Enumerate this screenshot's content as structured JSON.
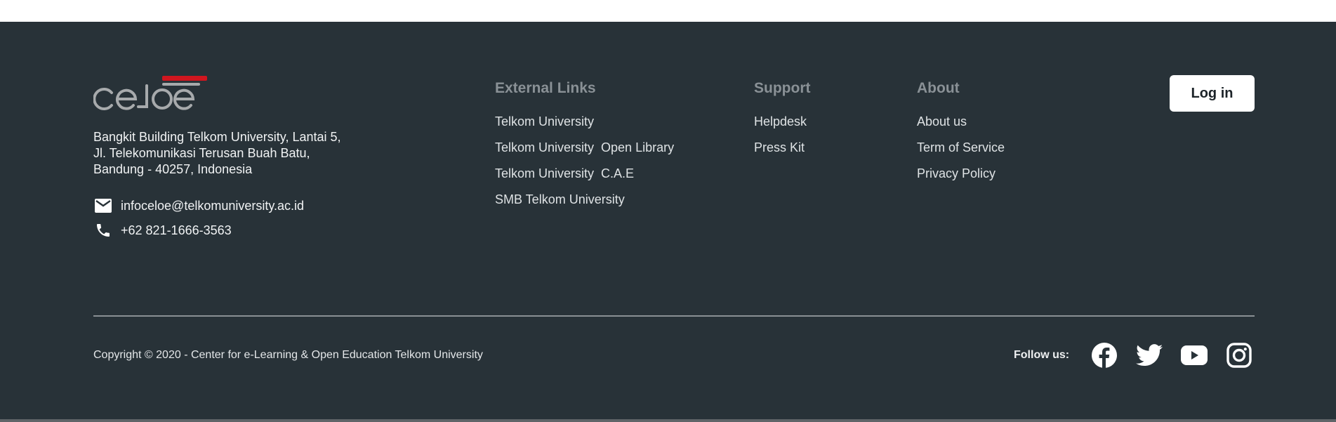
{
  "brand": {
    "logo_text": "celoe",
    "accent_color": "#d0161f",
    "footer_bg": "#283238"
  },
  "contact": {
    "address_lines": [
      "Bangkit Building Telkom University, Lantai 5,",
      "Jl. Telekomunikasi Terusan Buah Batu,",
      "Bandung - 40257, Indonesia"
    ],
    "email": "infoceloe@telkomuniversity.ac.id",
    "phone": "+62 821-1666-3563",
    "email_icon": "mail-icon",
    "phone_icon": "phone-icon"
  },
  "external_links": {
    "heading": "External Links",
    "items": [
      "Telkom University",
      "Telkom University  Open Library",
      "Telkom University  C.A.E",
      "SMB Telkom University"
    ]
  },
  "support": {
    "heading": "Support",
    "items": [
      "Helpdesk",
      "Press Kit"
    ]
  },
  "about": {
    "heading": "About",
    "items": [
      "About us",
      "Term of Service",
      "Privacy Policy"
    ]
  },
  "login_label": "Log in",
  "copyright": "Copyright © 2020 - Center for e-Learning & Open Education Telkom University",
  "follow_label": "Follow us:",
  "social_icons": [
    "facebook-icon",
    "twitter-icon",
    "youtube-icon",
    "instagram-icon"
  ]
}
